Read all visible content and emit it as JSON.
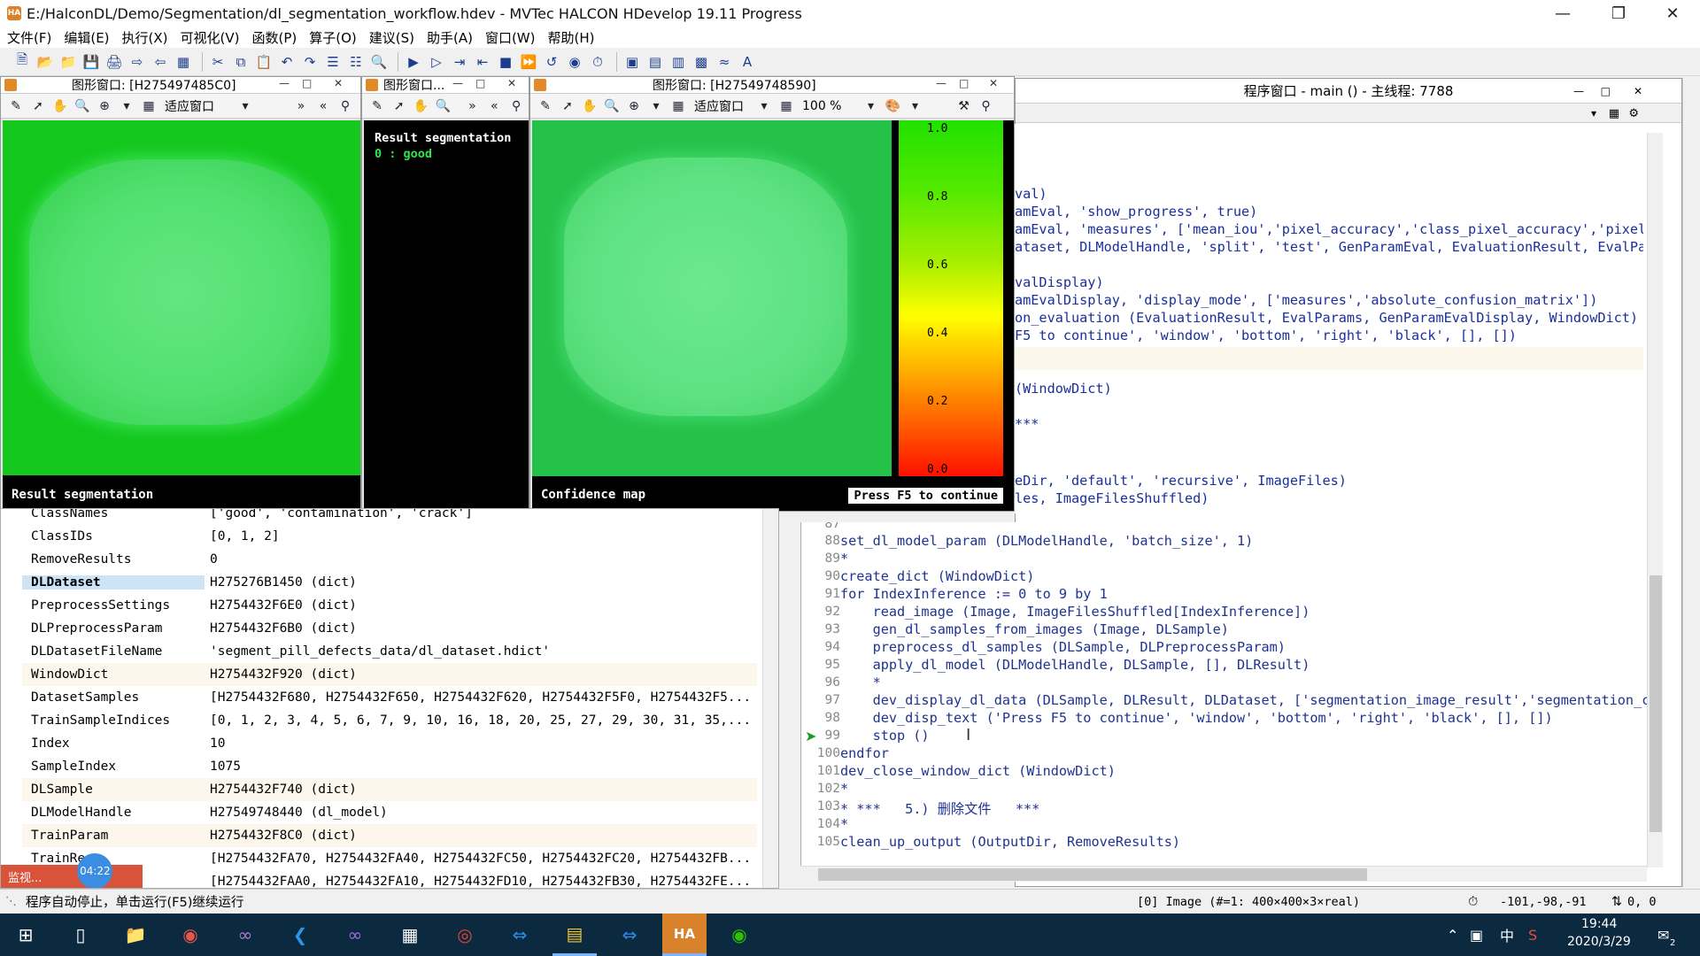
{
  "window": {
    "title": "E:/HalconDL/Demo/Segmentation/dl_segmentation_workflow.hdev - MVTec HALCON HDevelop 19.11 Progress",
    "app_icon": "HA"
  },
  "menu": [
    "文件(F)",
    "编辑(E)",
    "执行(X)",
    "可视化(V)",
    "函数(P)",
    "算子(O)",
    "建议(S)",
    "助手(A)",
    "窗口(W)",
    "帮助(H)"
  ],
  "graphics1": {
    "title": "图形窗口: [H275497485C0]",
    "zoom_mode": "适应窗口",
    "caption": "Result segmentation"
  },
  "graphics2": {
    "title": "图形窗口...",
    "legend_title": "Result segmentation",
    "legend_item": "0 : good"
  },
  "graphics3": {
    "title": "图形窗口: [H27549748590]",
    "zoom_mode": "适应窗口",
    "zoom_percent": "100 %",
    "caption": "Confidence map",
    "press_label": "Press F5 to continue",
    "colorbar_ticks": [
      "1.0",
      "0.8",
      "0.6",
      "0.4",
      "0.2",
      "0.0"
    ]
  },
  "variables": [
    {
      "name": "ClassNames",
      "value": "['good', 'contamination', 'crack']"
    },
    {
      "name": "ClassIDs",
      "value": "[0, 1, 2]"
    },
    {
      "name": "RemoveResults",
      "value": "0"
    },
    {
      "name": "DLDataset",
      "value": "H275276B1450 (dict)"
    },
    {
      "name": "PreprocessSettings",
      "value": "H2754432F6E0 (dict)"
    },
    {
      "name": "DLPreprocessParam",
      "value": "H2754432F6B0 (dict)"
    },
    {
      "name": "DLDatasetFileName",
      "value": "'segment_pill_defects_data/dl_dataset.hdict'"
    },
    {
      "name": "WindowDict",
      "value": "H2754432F920 (dict)"
    },
    {
      "name": "DatasetSamples",
      "value": "[H2754432F680, H2754432F650, H2754432F620, H2754432F5F0, H2754432F5..."
    },
    {
      "name": "TrainSampleIndices",
      "value": "[0, 1, 2, 3, 4, 5, 6, 7, 9, 10, 16, 18, 20, 25, 27, 29, 30, 31, 35,..."
    },
    {
      "name": "Index",
      "value": "10"
    },
    {
      "name": "SampleIndex",
      "value": "1075"
    },
    {
      "name": "DLSample",
      "value": "H2754432F740 (dict)"
    },
    {
      "name": "DLModelHandle",
      "value": "H27549748440 (dl_model)"
    },
    {
      "name": "TrainParam",
      "value": "H2754432F8C0 (dict)"
    },
    {
      "name": "TrainRe",
      "value": "[H2754432FA70, H2754432FA40, H2754432FC50, H2754432FC20, H2754432FB..."
    },
    {
      "name": "",
      "value": "[H2754432FAA0, H2754432FA10, H2754432FD10, H2754432FB30, H2754432FE..."
    }
  ],
  "monitor_badge": {
    "label": "监视...",
    "time": "04:22"
  },
  "program": {
    "title": "程序窗口 - main () - 主线程: 7788",
    "upper_lines": [
      "val)",
      "amEval, 'show_progress', true)",
      "amEval, 'measures', ['mean_iou','pixel_accuracy','class_pixel_accuracy','pixel_",
      "ataset, DLModelHandle, 'split', 'test', GenParamEval, EvaluationResult, EvalPar",
      "",
      "valDisplay)",
      "amEvalDisplay, 'display_mode', ['measures','absolute_confusion_matrix'])",
      "on_evaluation (EvaluationResult, EvalParams, GenParamEvalDisplay, WindowDict)",
      "F5 to continue', 'window', 'bottom', 'right', 'black', [], [])",
      "",
      "",
      "(WindowDict)",
      "",
      "***",
      "",
      "",
      "",
      "eDir, 'default', 'recursive', ImageFiles)",
      "les, ImageFilesShuffled)"
    ],
    "lines": [
      {
        "n": "87",
        "code": ""
      },
      {
        "n": "88",
        "code": "set_dl_model_param (DLModelHandle, 'batch_size', 1)"
      },
      {
        "n": "89",
        "code": "*"
      },
      {
        "n": "90",
        "code": "create_dict (WindowDict)"
      },
      {
        "n": "91",
        "code": "for IndexInference := 0 to 9 by 1"
      },
      {
        "n": "92",
        "code": "    read_image (Image, ImageFilesShuffled[IndexInference])"
      },
      {
        "n": "93",
        "code": "    gen_dl_samples_from_images (Image, DLSample)"
      },
      {
        "n": "94",
        "code": "    preprocess_dl_samples (DLSample, DLPreprocessParam)"
      },
      {
        "n": "95",
        "code": "    apply_dl_model (DLModelHandle, DLSample, [], DLResult)"
      },
      {
        "n": "96",
        "code": "    *"
      },
      {
        "n": "97",
        "code": "    dev_display_dl_data (DLSample, DLResult, DLDataset, ['segmentation_image_result','segmentation_co"
      },
      {
        "n": "98",
        "code": "    dev_disp_text ('Press F5 to continue', 'window', 'bottom', 'right', 'black', [], [])"
      },
      {
        "n": "99",
        "code": "    stop ()"
      },
      {
        "n": "100",
        "code": "endfor"
      },
      {
        "n": "101",
        "code": "dev_close_window_dict (WindowDict)"
      },
      {
        "n": "102",
        "code": "*"
      },
      {
        "n": "103",
        "code": "* ***   5.) 删除文件   ***"
      },
      {
        "n": "104",
        "code": "*"
      },
      {
        "n": "105",
        "code": "clean_up_output (OutputDir, RemoveResults)"
      }
    ]
  },
  "status": {
    "message": "程序自动停止，单击运行(F5)继续运行",
    "image_info": "[0] Image (#=1: 400×400×3×real)",
    "coords": "-101,-98,-91",
    "zoom": "0, 0"
  },
  "clock": {
    "time": "19:44",
    "date": "2020/3/29"
  },
  "tray": {
    "ime": "中",
    "notifications": "2"
  },
  "colors": {
    "segmentation_green": "#14c81e",
    "confidence_green": "#25c24a",
    "accent": "#0c2a3f"
  }
}
